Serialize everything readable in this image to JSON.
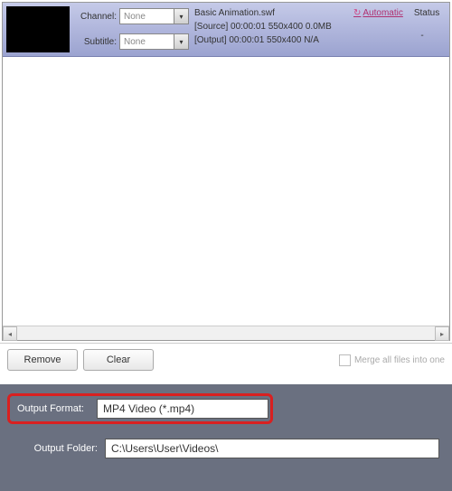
{
  "file": {
    "channel_label": "Channel:",
    "channel_value": "None",
    "subtitle_label": "Subtitle:",
    "subtitle_value": "None",
    "name": "Basic Animation.swf",
    "source_line": "[Source]  00:00:01  550x400  0.0MB",
    "output_line": "[Output]  00:00:01  550x400  N/A",
    "automatic_label": "Automatic",
    "status_label": "Status",
    "status_value": "-"
  },
  "buttons": {
    "remove": "Remove",
    "clear": "Clear",
    "merge": "Merge all files into one"
  },
  "settings": {
    "output_format_label": "Output Format:",
    "output_format_value": "MP4 Video (*.mp4)",
    "output_folder_label": "Output Folder:",
    "output_folder_value": "C:\\Users\\User\\Videos\\"
  }
}
